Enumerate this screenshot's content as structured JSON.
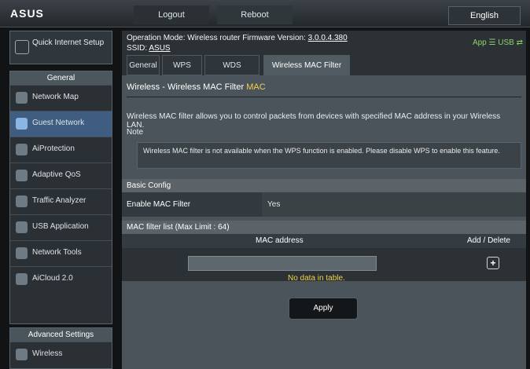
{
  "topbar": {
    "logo_text": "ASUS",
    "tab_1": "Logout",
    "tab_2": "Reboot",
    "logout_label": "English"
  },
  "sidebar": {
    "wizard_label": "Quick Internet Setup",
    "general_head": "General",
    "items": [
      {
        "label": "Network Map",
        "icon": "map-icon",
        "active": false
      },
      {
        "label": "Guest Network",
        "icon": "guest-icon",
        "active": true
      },
      {
        "label": "AiProtection",
        "icon": "shield-icon",
        "active": false
      },
      {
        "label": "Adaptive QoS",
        "icon": "qos-icon",
        "active": false
      },
      {
        "label": "Traffic Analyzer",
        "icon": "analyzer-icon",
        "active": false
      },
      {
        "label": "USB Application",
        "icon": "usb-icon",
        "active": false
      },
      {
        "label": "Network Tools",
        "icon": "tools-icon",
        "active": false
      },
      {
        "label": "AiCloud 2.0",
        "icon": "cloud-icon",
        "active": false
      }
    ],
    "advanced_head": "Advanced Settings",
    "advanced_items": [
      {
        "label": "Wireless",
        "icon": "wifi-icon"
      }
    ]
  },
  "header": {
    "status_line1": "Operation Mode: Wireless router Firmware Version:",
    "firmware_link": "3.0.0.4.380",
    "status_line2": "SSID:",
    "ssid_link": "ASUS",
    "icons_text": "App ☰ USB ⇄"
  },
  "tabs": [
    "General",
    "WPS",
    "WDS",
    "Wireless MAC Filter"
  ],
  "content": {
    "title": "Wireless - Wireless MAC Filter",
    "subtitle": "MAC",
    "description": "Wireless MAC filter allows you to control packets from devices with specified MAC address in your Wireless LAN.",
    "note_title": "Note",
    "note_text": "Wireless MAC filter is not available when the WPS function is enabled. Please disable WPS to enable this feature."
  },
  "settings": {
    "basic_head": "Basic Config",
    "enable_label": "Enable MAC Filter",
    "enable_value": "Yes"
  },
  "list": {
    "head": "MAC filter list (Max Limit : 64)",
    "col_1": "MAC address",
    "col_2": "Add / Delete",
    "input_value": "",
    "add_button": "+",
    "empty_text": "No data in table."
  },
  "buttons": {
    "apply": "Apply"
  }
}
